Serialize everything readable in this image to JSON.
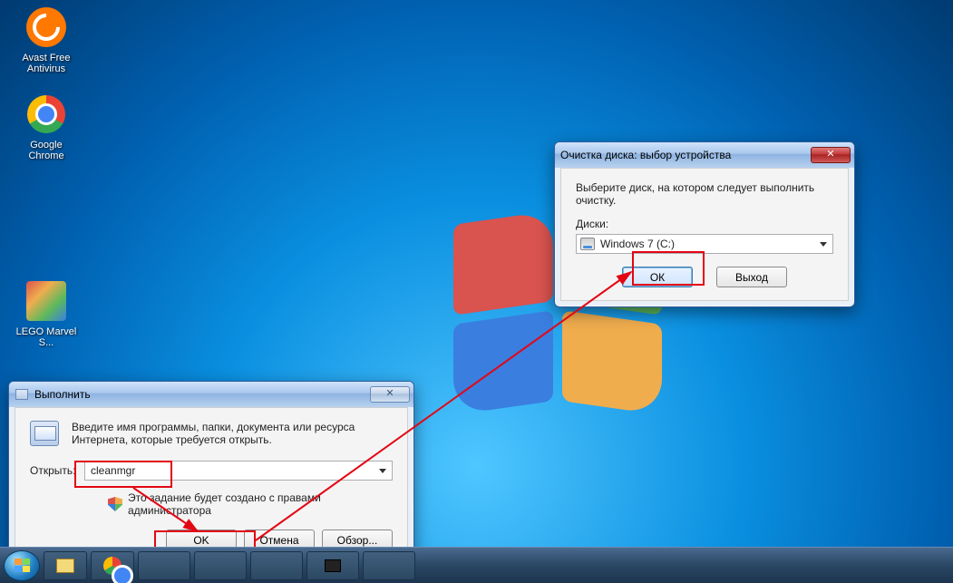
{
  "desktop_icons": {
    "avast": "Avast Free\nAntivirus",
    "chrome": "Google\nChrome",
    "lego": "LEGO Marvel\nS..."
  },
  "cleanup_dialog": {
    "title": "Очистка диска: выбор устройства",
    "instruction": "Выберите диск, на котором следует выполнить очистку.",
    "drives_label": "Диски:",
    "selected_drive": "Windows 7 (C:)",
    "ok_label": "ОК",
    "exit_label": "Выход"
  },
  "run_dialog": {
    "title": "Выполнить",
    "instruction": "Введите имя программы, папки, документа или ресурса Интернета, которые требуется открыть.",
    "open_label": "Открыть:",
    "value": "cleanmgr",
    "admin_hint": "Это задание будет создано с правами администратора",
    "ok_label": "OK",
    "cancel_label": "Отмена",
    "browse_label": "Обзор..."
  }
}
